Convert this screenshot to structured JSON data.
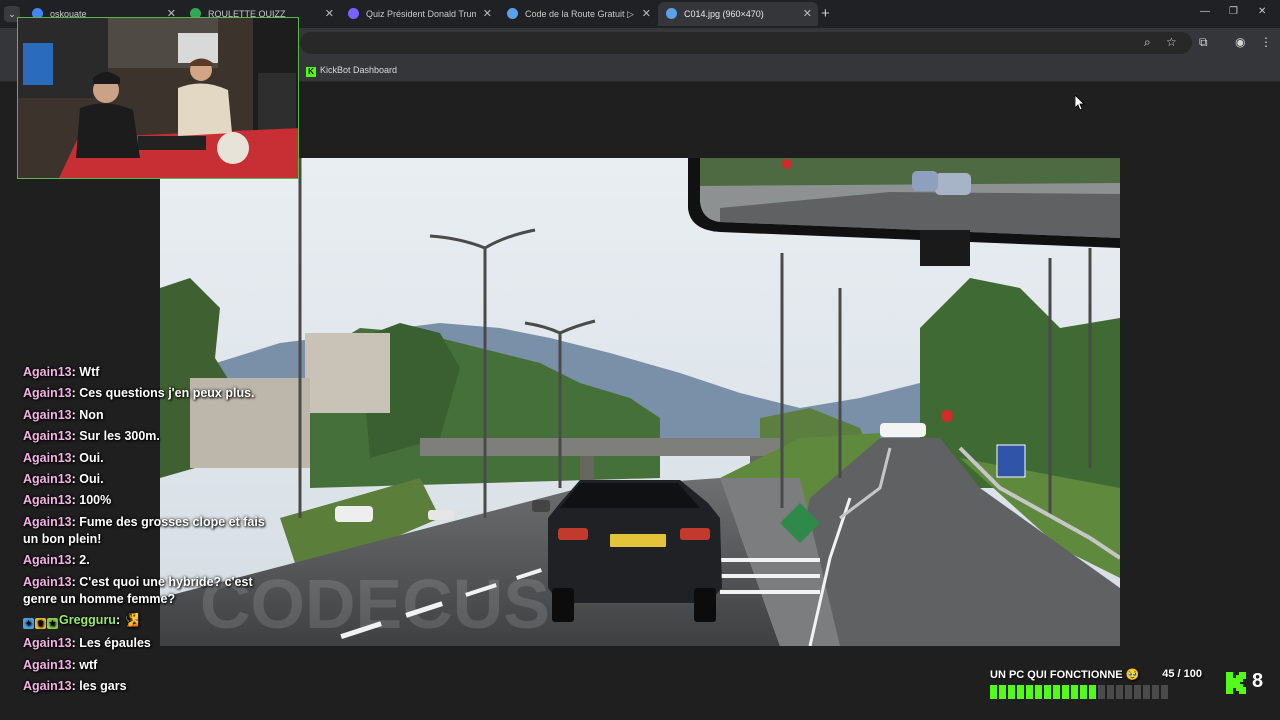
{
  "browser": {
    "tabs": [
      {
        "title": "oskouate",
        "active": false
      },
      {
        "title": "ROULETTE QUIZZ",
        "active": false
      },
      {
        "title": "Quiz Président Donald Trump -",
        "active": false
      },
      {
        "title": "Code de la Route Gratuit ▷ Tes",
        "active": false
      },
      {
        "title": "C014.jpg (960×470)",
        "active": true
      }
    ],
    "bookmark": "KickBot Dashboard"
  },
  "chat": {
    "messages": [
      {
        "user": "Again13",
        "text": "Wtf"
      },
      {
        "user": "Again13",
        "text": "Ces questions j'en peux plus."
      },
      {
        "user": "Again13",
        "text": "Non"
      },
      {
        "user": "Again13",
        "text": "Sur les 300m."
      },
      {
        "user": "Again13",
        "text": "Oui."
      },
      {
        "user": "Again13",
        "text": "Oui."
      },
      {
        "user": "Again13",
        "text": "100%"
      },
      {
        "user": "Again13",
        "text": "Fume des grosses clope et fais un bon plein!"
      },
      {
        "user": "Again13",
        "text": "2."
      },
      {
        "user": "Again13",
        "text": "C'est quoi une hybride? c'est genre un homme femme?"
      },
      {
        "user": "Gregguru",
        "text": "🧏",
        "badges": true
      },
      {
        "user": "Again13",
        "text": "Les épaules"
      },
      {
        "user": "Again13",
        "text": "wtf"
      },
      {
        "user": "Again13",
        "text": "les gars"
      }
    ]
  },
  "goal": {
    "title": "UN PC QUI FONCTIONNE 🥹",
    "count_label": "45 / 100",
    "current": 45,
    "target": 100,
    "segments": 20,
    "filled_segments": 12
  },
  "kick": {
    "count": "8",
    "color": "#53fc18"
  },
  "photo": {
    "watermark": "CODECUS"
  }
}
